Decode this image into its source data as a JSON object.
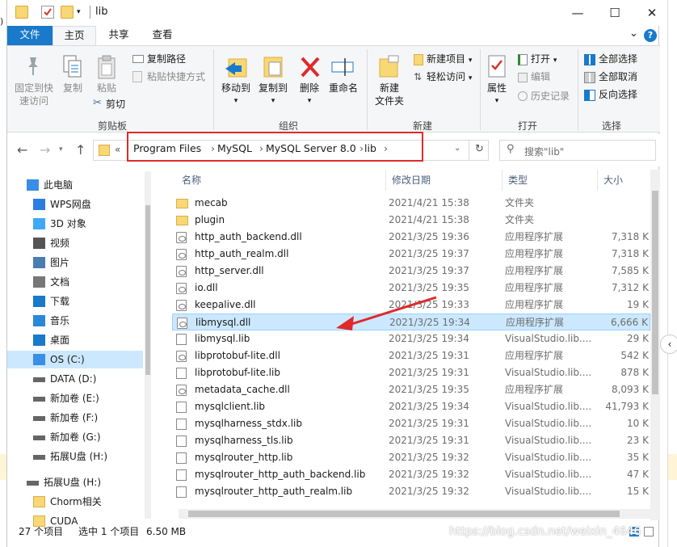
{
  "window": {
    "title": "lib",
    "minimize": "—",
    "maximize": "☐",
    "close": "✕",
    "help": "?",
    "collapse": "⌄"
  },
  "ribbon_tabs": [
    "文件",
    "主页",
    "共享",
    "查看"
  ],
  "ribbon": {
    "clipboard": {
      "pin_line1": "固定到快",
      "pin_line2": "速访问",
      "copy": "复制",
      "paste": "粘贴",
      "copy_path": "复制路径",
      "paste_shortcut": "粘贴快捷方式",
      "cut": "剪切",
      "group": "剪贴板"
    },
    "organize": {
      "move_to": "移动到",
      "copy_to": "复制到",
      "delete": "删除",
      "rename": "重命名",
      "group": "组织"
    },
    "new": {
      "new_folder_line1": "新建",
      "new_folder_line2": "文件夹",
      "new_item": "新建项目",
      "easy_access": "轻松访问",
      "group": "新建"
    },
    "open": {
      "properties": "属性",
      "open": "打开",
      "edit": "编辑",
      "history": "历史记录",
      "group": "打开"
    },
    "select": {
      "select_all": "全部选择",
      "select_none": "全部取消",
      "invert": "反向选择",
      "group": "选择"
    }
  },
  "address": {
    "overflow": "«",
    "crumbs": [
      "Program Files",
      "MySQL",
      "MySQL Server 8.0",
      "lib"
    ],
    "sep": "›",
    "search_placeholder": "搜索\"lib\""
  },
  "nav": [
    {
      "label": "此电脑",
      "icon": "pc-icon"
    },
    {
      "label": "WPS网盘",
      "icon": "cloud-icon"
    },
    {
      "label": "3D 对象",
      "icon": "cube-icon"
    },
    {
      "label": "视频",
      "icon": "video-icon"
    },
    {
      "label": "图片",
      "icon": "picture-icon"
    },
    {
      "label": "文档",
      "icon": "document-icon"
    },
    {
      "label": "下载",
      "icon": "download-icon"
    },
    {
      "label": "音乐",
      "icon": "music-icon"
    },
    {
      "label": "桌面",
      "icon": "desktop-icon"
    },
    {
      "label": "OS (C:)",
      "icon": "drive-c-icon",
      "selected": true
    },
    {
      "label": "DATA (D:)",
      "icon": "drive-icon"
    },
    {
      "label": "新加卷 (E:)",
      "icon": "drive-icon"
    },
    {
      "label": "新加卷 (F:)",
      "icon": "drive-icon"
    },
    {
      "label": "新加卷 (G:)",
      "icon": "drive-icon"
    },
    {
      "label": "拓展U盘 (H:)",
      "icon": "usb-drive-icon"
    },
    {
      "label": "拓展U盘 (H:)",
      "icon": "usb-drive-icon"
    },
    {
      "label": "Chorm相关",
      "icon": "folder-icon"
    },
    {
      "label": "CUDA",
      "icon": "folder-icon"
    }
  ],
  "columns": {
    "name": "名称",
    "date": "修改日期",
    "type": "类型",
    "size": "大小"
  },
  "files": [
    {
      "name": "mecab",
      "date": "2021/4/21 15:38",
      "type": "文件夹",
      "size": "",
      "kind": "folder"
    },
    {
      "name": "plugin",
      "date": "2021/4/21 15:38",
      "type": "文件夹",
      "size": "",
      "kind": "folder"
    },
    {
      "name": "http_auth_backend.dll",
      "date": "2021/3/25 19:36",
      "type": "应用程序扩展",
      "size": "7,318 K",
      "kind": "dll"
    },
    {
      "name": "http_auth_realm.dll",
      "date": "2021/3/25 19:37",
      "type": "应用程序扩展",
      "size": "7,318 K",
      "kind": "dll"
    },
    {
      "name": "http_server.dll",
      "date": "2021/3/25 19:37",
      "type": "应用程序扩展",
      "size": "7,585 K",
      "kind": "dll"
    },
    {
      "name": "io.dll",
      "date": "2021/3/25 19:35",
      "type": "应用程序扩展",
      "size": "7,312 K",
      "kind": "dll"
    },
    {
      "name": "keepalive.dll",
      "date": "2021/3/25 19:33",
      "type": "应用程序扩展",
      "size": "19 K",
      "kind": "dll"
    },
    {
      "name": "libmysql.dll",
      "date": "2021/3/25 19:34",
      "type": "应用程序扩展",
      "size": "6,666 K",
      "kind": "dll",
      "selected": true
    },
    {
      "name": "libmysql.lib",
      "date": "2021/3/25 19:34",
      "type": "VisualStudio.lib....",
      "size": "29 K",
      "kind": "lib"
    },
    {
      "name": "libprotobuf-lite.dll",
      "date": "2021/3/25 19:31",
      "type": "应用程序扩展",
      "size": "542 K",
      "kind": "dll"
    },
    {
      "name": "libprotobuf-lite.lib",
      "date": "2021/3/25 19:31",
      "type": "VisualStudio.lib....",
      "size": "878 K",
      "kind": "lib"
    },
    {
      "name": "metadata_cache.dll",
      "date": "2021/3/25 19:35",
      "type": "应用程序扩展",
      "size": "8,093 K",
      "kind": "dll"
    },
    {
      "name": "mysqlclient.lib",
      "date": "2021/3/25 19:34",
      "type": "VisualStudio.lib....",
      "size": "41,793 K",
      "kind": "lib"
    },
    {
      "name": "mysqlharness_stdx.lib",
      "date": "2021/3/25 19:31",
      "type": "VisualStudio.lib....",
      "size": "10 K",
      "kind": "lib"
    },
    {
      "name": "mysqlharness_tls.lib",
      "date": "2021/3/25 19:31",
      "type": "VisualStudio.lib....",
      "size": "23 K",
      "kind": "lib"
    },
    {
      "name": "mysqlrouter_http.lib",
      "date": "2021/3/25 19:32",
      "type": "VisualStudio.lib....",
      "size": "35 K",
      "kind": "lib"
    },
    {
      "name": "mysqlrouter_http_auth_backend.lib",
      "date": "2021/3/25 19:32",
      "type": "VisualStudio.lib....",
      "size": "47 K",
      "kind": "lib"
    },
    {
      "name": "mysqlrouter_http_auth_realm.lib",
      "date": "2021/3/25 19:32",
      "type": "VisualStudio.lib....",
      "size": "15 K",
      "kind": "lib"
    }
  ],
  "status": {
    "count": "27 个项目",
    "selected": "选中 1 个项目",
    "size": "6.50 MB"
  },
  "watermark": "https://blog.csdn.net/weixin_4646",
  "annotation_color": "#e0292b"
}
